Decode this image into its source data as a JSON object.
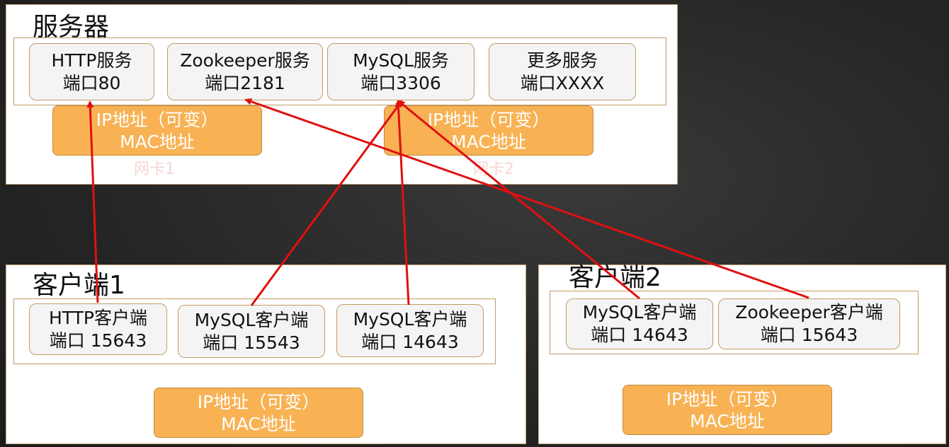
{
  "server": {
    "title": "服务器",
    "services": [
      {
        "name": "HTTP服务",
        "port": "端口80"
      },
      {
        "name": "Zookeeper服务",
        "port": "端口2181"
      },
      {
        "name": "MySQL服务",
        "port": "端口3306"
      },
      {
        "name": "更多服务",
        "port": "端口XXXX"
      }
    ],
    "nics": [
      {
        "ip": "IP地址（可变）",
        "mac": "MAC地址",
        "caption": "网卡1"
      },
      {
        "ip": "IP地址（可变）",
        "mac": "MAC地址",
        "caption": "网卡2"
      }
    ]
  },
  "client1": {
    "title": "客户端1",
    "clients": [
      {
        "name": "HTTP客户端",
        "port": "端口 15643"
      },
      {
        "name": "MySQL客户端",
        "port": "端口 15543"
      },
      {
        "name": "MySQL客户端",
        "port": "端口 14643"
      }
    ],
    "nic": {
      "ip": "IP地址（可变）",
      "mac": "MAC地址"
    }
  },
  "client2": {
    "title": "客户端2",
    "clients": [
      {
        "name": "MySQL客户端",
        "port": "端口 14643"
      },
      {
        "name": "Zookeeper客户端",
        "port": "端口 15643"
      }
    ],
    "nic": {
      "ip": "IP地址（可变）",
      "mac": "MAC地址"
    }
  },
  "colors": {
    "arrow": "#e01010",
    "nic_fill": "#f8b254",
    "service_fill": "#f4f4f4",
    "border": "#c49a66"
  }
}
